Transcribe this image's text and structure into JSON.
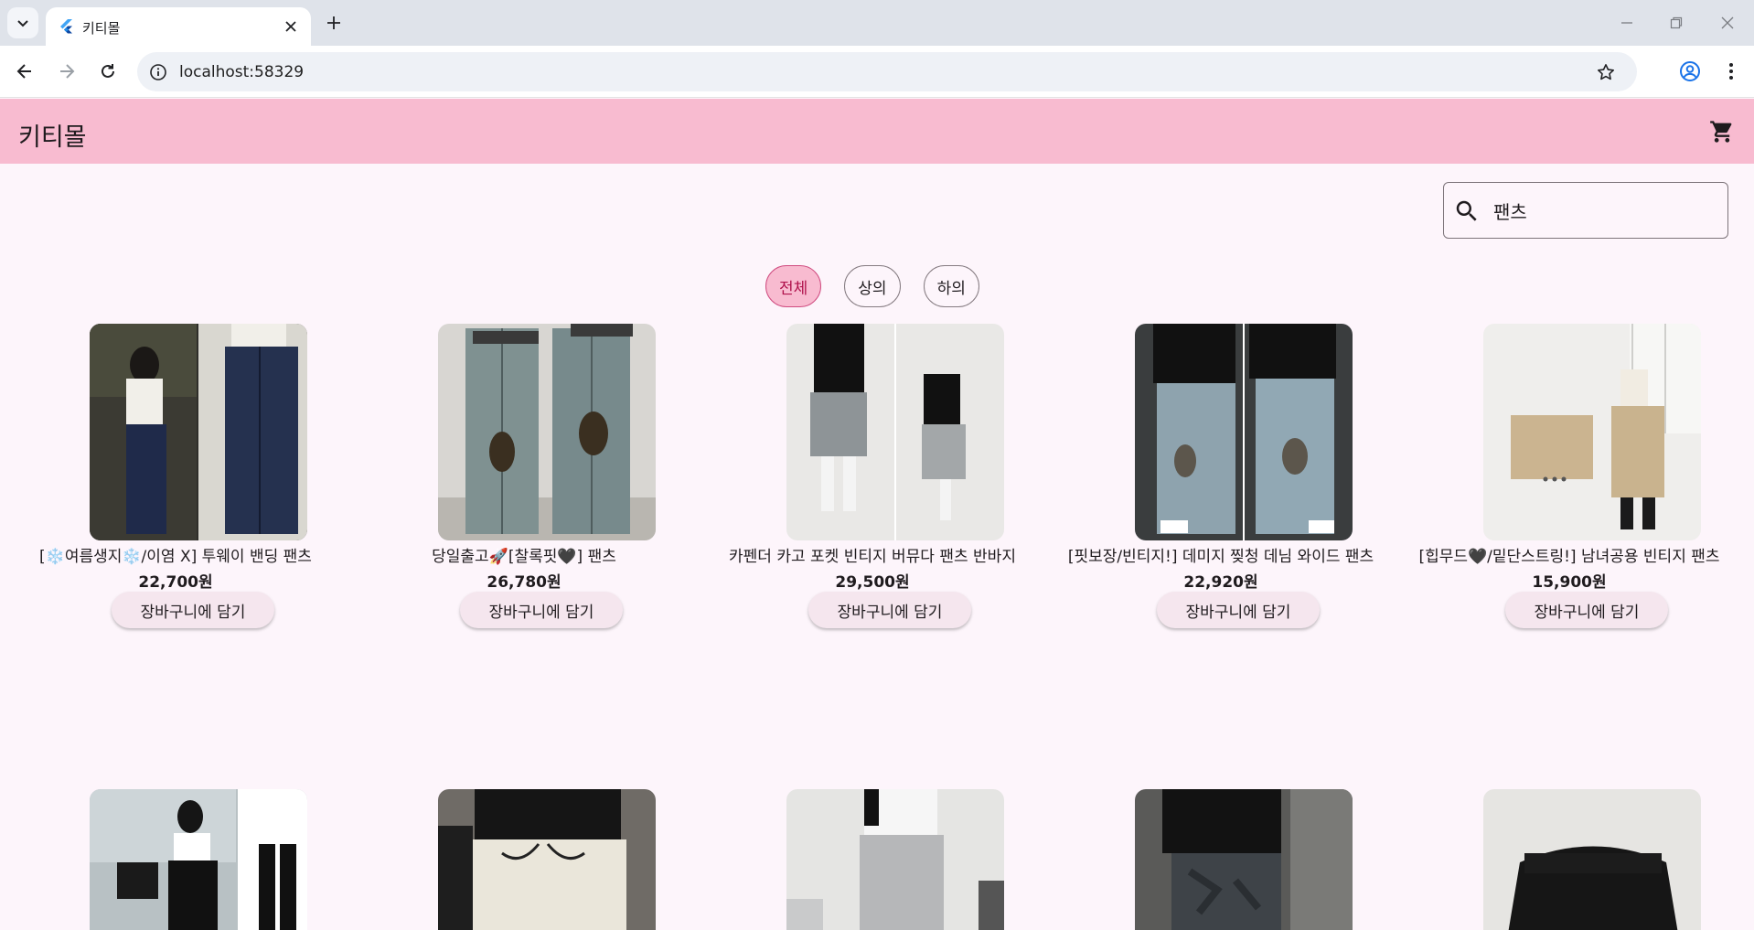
{
  "browser": {
    "tab_title": "키티몰",
    "url": "localhost:58329"
  },
  "app": {
    "title": "키티몰",
    "accent_color": "#f8bbd0",
    "background_color": "#fdf5fb"
  },
  "search": {
    "value": "팬츠"
  },
  "filters": [
    {
      "label": "전체",
      "selected": true
    },
    {
      "label": "상의",
      "selected": false
    },
    {
      "label": "하의",
      "selected": false
    }
  ],
  "products": [
    {
      "name": "[❄️여름생지❄️/이염 X] 투웨이 밴딩 팬츠",
      "price": "22,700원",
      "button": "장바구니에 담기"
    },
    {
      "name": "당일출고🚀[찰록핏🖤] 팬츠",
      "price": "26,780원",
      "button": "장바구니에 담기"
    },
    {
      "name": "카펜더 카고 포켓 빈티지 버뮤다 팬츠 반바지",
      "price": "29,500원",
      "button": "장바구니에 담기"
    },
    {
      "name": "[핏보장/빈티지!] 데미지 찢청 데님 와이드 팬츠",
      "price": "22,920원",
      "button": "장바구니에 담기"
    },
    {
      "name": "[힙무드🖤/밑단스트링!] 남녀공용 빈티지 팬츠",
      "price": "15,900원",
      "button": "장바구니에 담기"
    },
    {
      "name": "",
      "price": "",
      "button": ""
    },
    {
      "name": "",
      "price": "",
      "button": ""
    },
    {
      "name": "",
      "price": "",
      "button": ""
    },
    {
      "name": "",
      "price": "",
      "button": ""
    },
    {
      "name": "",
      "price": "",
      "button": ""
    }
  ]
}
